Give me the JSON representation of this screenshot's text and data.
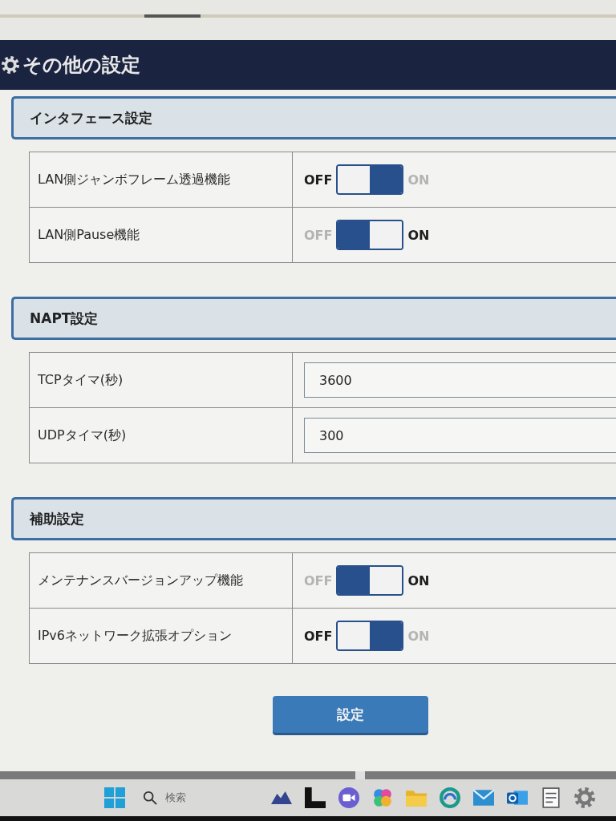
{
  "page_title": "その他の設定",
  "sections": [
    {
      "title": "インタフェース設定",
      "rows": [
        {
          "kind": "toggle",
          "label": "LAN側ジャンボフレーム透過機能",
          "off_label": "OFF",
          "on_label": "ON",
          "on": false
        },
        {
          "kind": "toggle",
          "label": "LAN側Pause機能",
          "off_label": "OFF",
          "on_label": "ON",
          "on": true
        }
      ]
    },
    {
      "title": "NAPT設定",
      "rows": [
        {
          "kind": "input",
          "label": "TCPタイマ(秒)",
          "value": "3600"
        },
        {
          "kind": "input",
          "label": "UDPタイマ(秒)",
          "value": "300"
        }
      ]
    },
    {
      "title": "補助設定",
      "rows": [
        {
          "kind": "toggle",
          "label": "メンテナンスバージョンアップ機能",
          "off_label": "OFF",
          "on_label": "ON",
          "on": true
        },
        {
          "kind": "toggle",
          "label": "IPv6ネットワーク拡張オプション",
          "off_label": "OFF",
          "on_label": "ON",
          "on": false
        }
      ]
    }
  ],
  "submit_button": "設定",
  "taskbar": {
    "search_placeholder": "検索"
  }
}
